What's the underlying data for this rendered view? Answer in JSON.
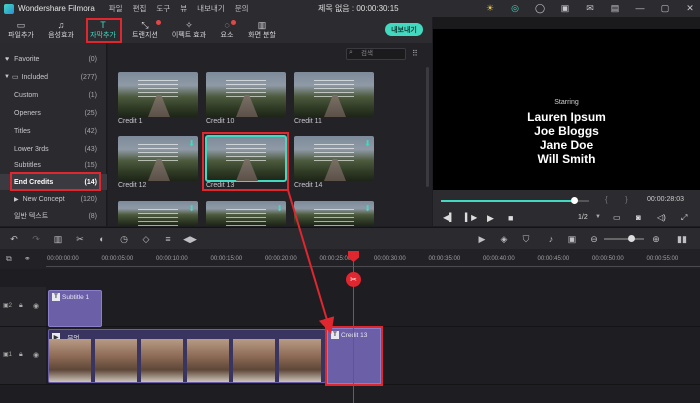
{
  "app": {
    "name": "Wondershare Filmora",
    "menu": [
      "파일",
      "편집",
      "도구",
      "뷰",
      "내보내기",
      "문의"
    ],
    "document_title": "제목 없음 : 00:00:30:15"
  },
  "toolbar": {
    "tabs": [
      {
        "label": "파일추가",
        "icon": "folder-icon"
      },
      {
        "label": "음성효과",
        "icon": "music-note-icon"
      },
      {
        "label": "자막추가",
        "icon": "text-t-icon"
      },
      {
        "label": "트랜지션",
        "icon": "transition-icon"
      },
      {
        "label": "이펙트 효과",
        "icon": "sparkle-icon"
      },
      {
        "label": "요소",
        "icon": "shapes-icon"
      },
      {
        "label": "화면 분할",
        "icon": "split-screen-icon"
      }
    ],
    "export_label": "내보내기"
  },
  "sidebar": {
    "items": [
      {
        "label": "Favorite",
        "count": "(0)"
      },
      {
        "label": "Included",
        "count": "(277)"
      },
      {
        "label": "Custom",
        "count": "(1)"
      },
      {
        "label": "Openers",
        "count": "(25)"
      },
      {
        "label": "Titles",
        "count": "(42)"
      },
      {
        "label": "Lower 3rds",
        "count": "(43)"
      },
      {
        "label": "Subtitles",
        "count": "(15)"
      },
      {
        "label": "End Credits",
        "count": "(14)"
      },
      {
        "label": "New Concept",
        "count": "(120)"
      },
      {
        "label": "일반 텍스트",
        "count": "(8)"
      }
    ]
  },
  "library": {
    "search_placeholder": "검색",
    "items": [
      {
        "label": "Credit 1"
      },
      {
        "label": "Credit 10"
      },
      {
        "label": "Credit 11"
      },
      {
        "label": "Credit 12"
      },
      {
        "label": "Credit 13"
      },
      {
        "label": "Credit 14"
      }
    ]
  },
  "preview": {
    "starring_label": "Starring",
    "names": [
      "Lauren Ipsum",
      "Joe Bloggs",
      "Jane Doe",
      "Will Smith"
    ],
    "timecode": "00:00:28:03",
    "speed": "1/2",
    "progress": 0.9
  },
  "timeline": {
    "ticks": [
      "00:00:00:00",
      "00:00:05:00",
      "00:00:10:00",
      "00:00:15:00",
      "00:00:20:00",
      "00:00:25:00",
      "00:00:30:00",
      "00:00:35:00",
      "00:00:40:00",
      "00:00:45:00",
      "00:00:50:00",
      "00:00:55:00"
    ],
    "clips": {
      "subtitle": "Subtitle 1",
      "video": "...무엇",
      "credit": "Credit 13"
    }
  },
  "colors": {
    "accent": "#43d9c0",
    "highlight_red": "#e0262f",
    "clip_purple": "#6b5fa8"
  }
}
